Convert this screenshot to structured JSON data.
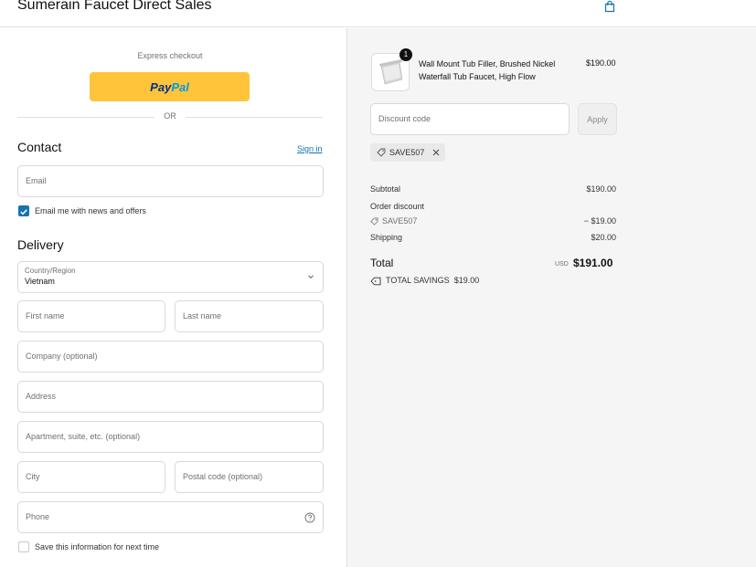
{
  "header": {
    "brand": "Sumerain Faucet Direct Sales",
    "cart_icon": "shopping-bag-icon"
  },
  "express": {
    "title": "Express checkout",
    "paypal_part1": "Pay",
    "paypal_part2": "Pal",
    "or": "OR"
  },
  "contact": {
    "title": "Contact",
    "sign_in": "Sign in",
    "email_placeholder": "Email",
    "newsletter_label": "Email me with news and offers",
    "newsletter_checked": true
  },
  "delivery": {
    "title": "Delivery",
    "country_label": "Country/Region",
    "country_value": "Vietnam",
    "first_name": "First name",
    "last_name": "Last name",
    "company": "Company (optional)",
    "address": "Address",
    "apartment": "Apartment, suite, etc. (optional)",
    "city": "City",
    "postal": "Postal code (optional)",
    "phone": "Phone",
    "save_info": "Save this information for next time"
  },
  "summary": {
    "product": {
      "quantity": "1",
      "name": "Wall Mount Tub Filler, Brushed Nickel Waterfall Tub Faucet, High Flow",
      "price": "$190.00"
    },
    "discount_placeholder": "Discount code",
    "apply": "Apply",
    "applied_code": "SAVE507",
    "subtotal_label": "Subtotal",
    "subtotal_value": "$190.00",
    "order_discount_label": "Order discount",
    "order_discount_code": "SAVE507",
    "order_discount_value": "− $19.00",
    "shipping_label": "Shipping",
    "shipping_value": "$20.00",
    "total_label": "Total",
    "currency": "USD",
    "total_value": "$191.00",
    "savings_label": "TOTAL SAVINGS",
    "savings_value": "$19.00"
  },
  "colors": {
    "accent": "#1773b0",
    "paypal": "#ffc439",
    "panel": "#f5f5f5"
  }
}
